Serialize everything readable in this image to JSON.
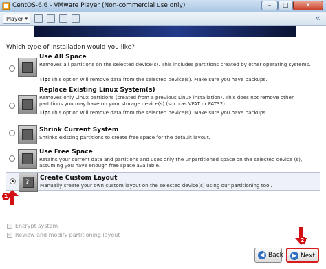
{
  "window": {
    "title": "CentOS-6.6 - VMware Player (Non-commercial use only)",
    "minimize_glyph": "–",
    "maximize_glyph": "□",
    "close_glyph": "✕"
  },
  "toolbar": {
    "player_label": "Player",
    "player_caret": "▾",
    "back_glyph": "«"
  },
  "installer": {
    "question": "Which type of installation would you like?",
    "options": [
      {
        "title": "Use All Space",
        "description": "Removes all partitions on the selected device(s).  This includes partitions created by other operating systems.",
        "tip_label": "Tip:",
        "tip_text": " This option will remove data from the selected device(s).  Make sure you have backups.",
        "selected": false
      },
      {
        "title": "Replace Existing Linux System(s)",
        "description": "Removes only Linux partitions (created from a previous Linux installation). This does not remove other partitions you may have on your storage device(s) (such as VFAT or FAT32).",
        "tip_label": "Tip:",
        "tip_text": " This option will remove data from the selected device(s).  Make sure you have backups.",
        "selected": false
      },
      {
        "title": "Shrink Current System",
        "description": "Shrinks existing partitions to create free space for the default layout.",
        "selected": false
      },
      {
        "title": "Use Free Space",
        "description": "Retains your current data and partitions and uses only the unpartitioned space on the selected device (s), assuming you have enough free space available.",
        "selected": false
      },
      {
        "title": "Create Custom Layout",
        "description": "Manually create your own custom layout on the selected device(s) using our partitioning tool.",
        "selected": true
      }
    ],
    "encrypt_label": "Encrypt system",
    "review_label": "Review and modify partitioning layout",
    "back_label": "Back",
    "next_label": "Next",
    "back_glyph": "◀",
    "next_glyph": "▶"
  },
  "annotations": {
    "step1": "1",
    "step2": "2",
    "color": "#d20f12"
  }
}
